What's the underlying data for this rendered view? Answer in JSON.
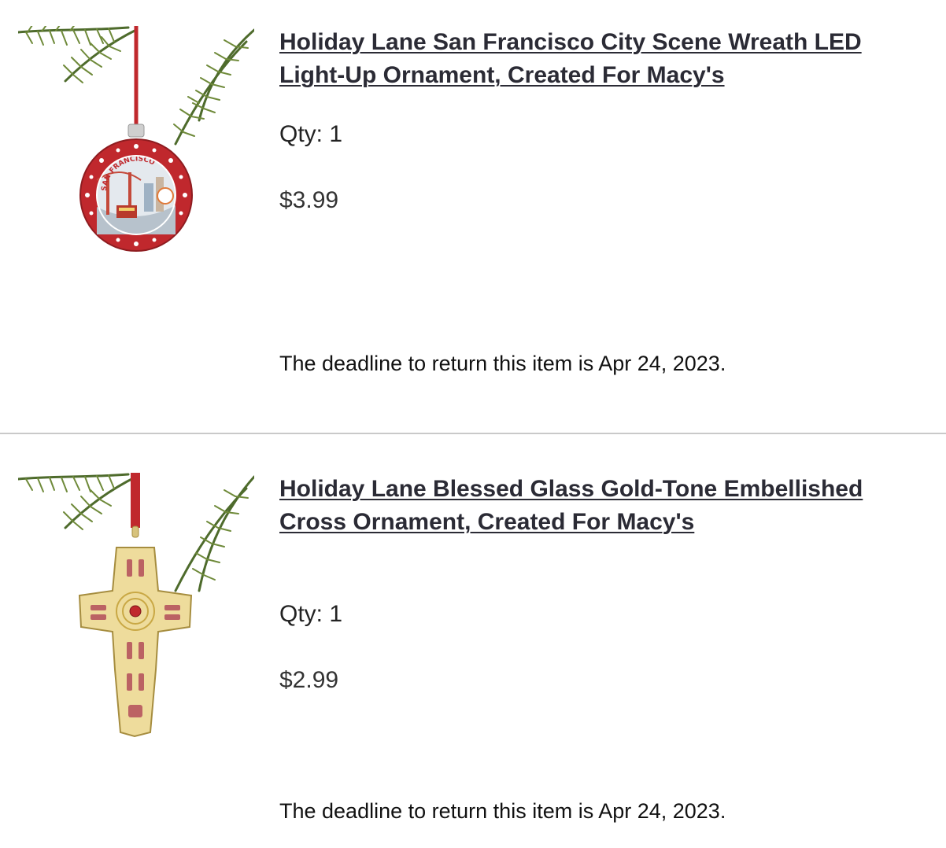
{
  "order_items": [
    {
      "title": "Holiday Lane San Francisco City Scene Wreath LED Light-Up Ornament, Created For Macy's",
      "qty": "Qty: 1",
      "price": "$3.99",
      "return_notice": "The deadline to return this item is Apr 24, 2023.",
      "ornament_text": "SAN FRANCISCO",
      "image_icon": "ornament-image"
    },
    {
      "title": "Holiday Lane Blessed Glass Gold-Tone Embellished Cross Ornament, Created For Macy's",
      "qty": "Qty: 1",
      "price": "$2.99",
      "return_notice": "The deadline to return this item is Apr 24, 2023.",
      "image_icon": "ornament-image"
    }
  ],
  "colors": {
    "link_text": "#2b2b35",
    "divider": "#c9c9c9",
    "ornament_red": "#c0282d",
    "cross_gold": "#e9d79a"
  }
}
